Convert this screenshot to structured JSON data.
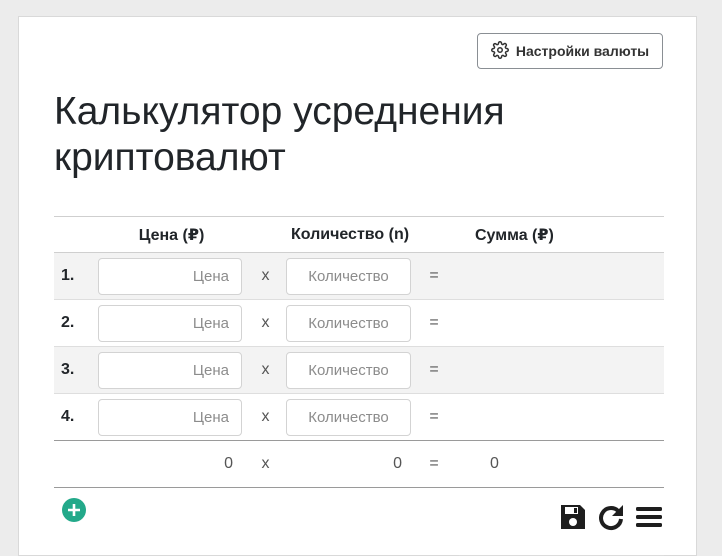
{
  "settings_button": {
    "label": "Настройки валюты",
    "icon": "gear-icon"
  },
  "title": "Калькулятор усреднения криптовалют",
  "table": {
    "headers": {
      "price": "Цена (₽)",
      "quantity": "Количество (n)",
      "sum": "Сумма (₽)"
    },
    "rows": [
      {
        "num": "1.",
        "price_placeholder": "Цена",
        "qty_placeholder": "Количество",
        "op_x": "x",
        "op_eq": "="
      },
      {
        "num": "2.",
        "price_placeholder": "Цена",
        "qty_placeholder": "Количество",
        "op_x": "x",
        "op_eq": "="
      },
      {
        "num": "3.",
        "price_placeholder": "Цена",
        "qty_placeholder": "Количество",
        "op_x": "x",
        "op_eq": "="
      },
      {
        "num": "4.",
        "price_placeholder": "Цена",
        "qty_placeholder": "Количество",
        "op_x": "x",
        "op_eq": "="
      }
    ],
    "totals": {
      "price": "0",
      "op_x": "x",
      "quantity": "0",
      "op_eq": "=",
      "sum": "0"
    }
  },
  "icons": {
    "add": "plus-circle-icon",
    "save": "floppy-disk-icon",
    "reset": "reload-icon",
    "menu": "hamburger-menu-icon"
  },
  "colors": {
    "accent_green": "#23a98a",
    "total_green": "#2e7d32"
  }
}
